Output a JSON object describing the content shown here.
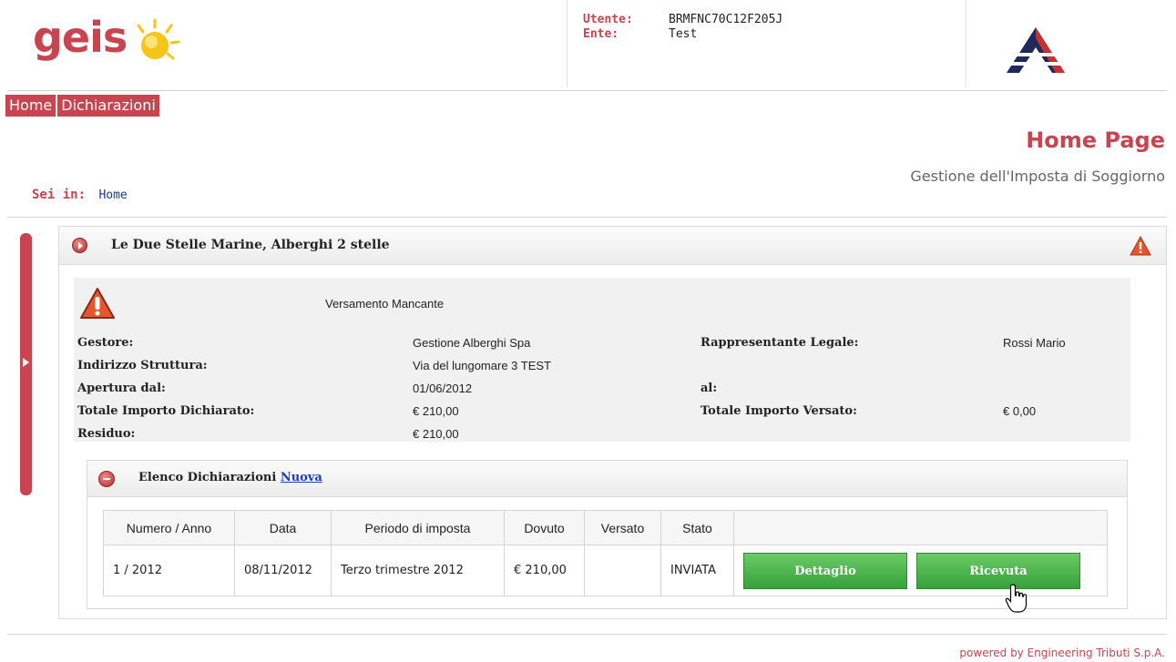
{
  "brand": {
    "logo_text": "geis",
    "accent": "#c9444f",
    "sun_color": "#f5c518"
  },
  "user": {
    "utente_label": "Utente:",
    "utente_value": "BRMFNC70C12F205J",
    "ente_label": "Ente:",
    "ente_value": "Test"
  },
  "menu": {
    "items": [
      {
        "label": "Home"
      },
      {
        "label": "Dichiarazioni"
      }
    ]
  },
  "page": {
    "title": "Home Page",
    "subtitle": "Gestione dell'Imposta di Soggiorno"
  },
  "breadcrumb": {
    "label": "Sei in:",
    "current": "Home"
  },
  "panel": {
    "title": "Le Due Stelle Marine, Alberghi 2 stelle",
    "warning_text": "Versamento Mancante",
    "fields": {
      "gestore_label": "Gestore:",
      "gestore_value": "Gestione Alberghi Spa",
      "rappresentante_label": "Rappresentante Legale:",
      "rappresentante_value": "Rossi Mario",
      "indirizzo_label": "Indirizzo Struttura:",
      "indirizzo_value": "Via del lungomare 3 TEST",
      "apertura_label": "Apertura dal:",
      "apertura_value": "01/06/2012",
      "al_label": "al:",
      "totale_dichiarato_label": "Totale Importo Dichiarato:",
      "totale_dichiarato_value": "€ 210,00",
      "totale_versato_label": "Totale Importo Versato:",
      "totale_versato_value": "€ 0,00",
      "residuo_label": "Residuo:",
      "residuo_value": "€ 210,00"
    }
  },
  "dichiarazioni": {
    "title": "Elenco Dichiarazioni",
    "new_link": "Nuova",
    "columns": [
      "Numero / Anno",
      "Data",
      "Periodo di imposta",
      "Dovuto",
      "Versato",
      "Stato",
      ""
    ],
    "rows": [
      {
        "numero": "1 / 2012",
        "data": "08/11/2012",
        "periodo": "Terzo trimestre 2012",
        "dovuto": "€ 210,00",
        "versato": "",
        "stato": "INVIATA",
        "btn_dettaglio": "Dettaglio",
        "btn_ricevuta": "Ricevuta"
      }
    ]
  },
  "footer": {
    "text": "powered by Engineering Tributi S.p.A."
  }
}
